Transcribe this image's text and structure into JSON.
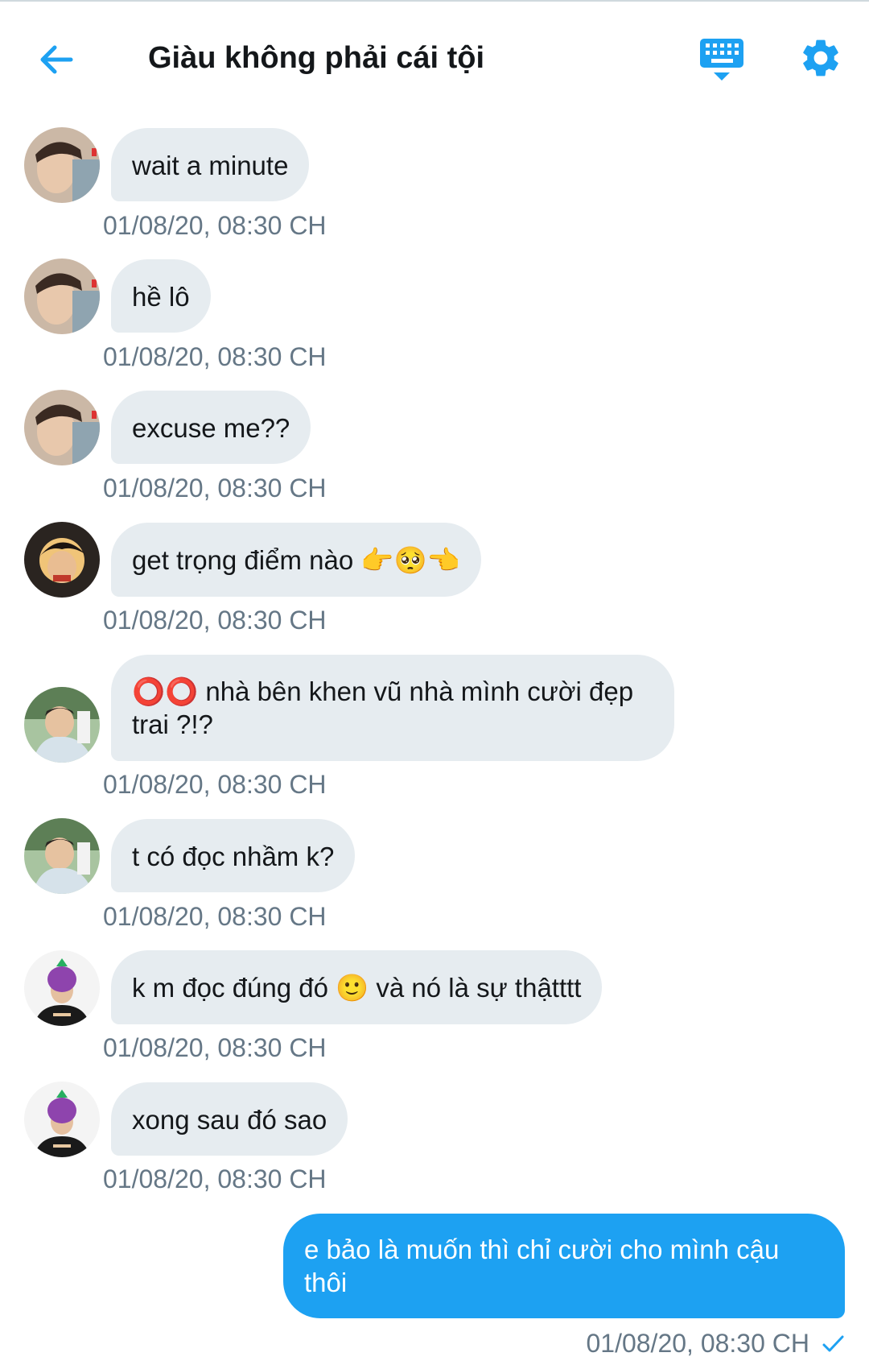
{
  "header": {
    "title": "Giàu không phải cái tội",
    "accent": "#1da1f2"
  },
  "messages": [
    {
      "text": "wait a minute",
      "time": "01/08/20, 08:30 CH"
    },
    {
      "text": "hề lô",
      "time": "01/08/20, 08:30 CH"
    },
    {
      "text": "excuse me??",
      "time": "01/08/20, 08:30 CH"
    },
    {
      "text": "get trọng điểm nào 👉🥺👈",
      "time": "01/08/20, 08:30 CH"
    },
    {
      "text": "⭕⭕ nhà bên khen vũ nhà mình cười đẹp trai ?!?",
      "time": "01/08/20, 08:30 CH"
    },
    {
      "text": "t có đọc nhầm k?",
      "time": "01/08/20, 08:30 CH"
    },
    {
      "text": "k m đọc đúng đó 🙂 và nó là sự thậtttt",
      "time": "01/08/20, 08:30 CH"
    },
    {
      "text": "xong sau đó sao",
      "time": "01/08/20, 08:30 CH"
    }
  ],
  "outgoing": {
    "text": "e bảo là muốn thì chỉ cười cho mình cậu thôi",
    "time": "01/08/20, 08:30 CH"
  },
  "colors": {
    "bubble_in": "#e6ecf0",
    "bubble_out": "#1da1f2",
    "timestamp": "#657786"
  }
}
